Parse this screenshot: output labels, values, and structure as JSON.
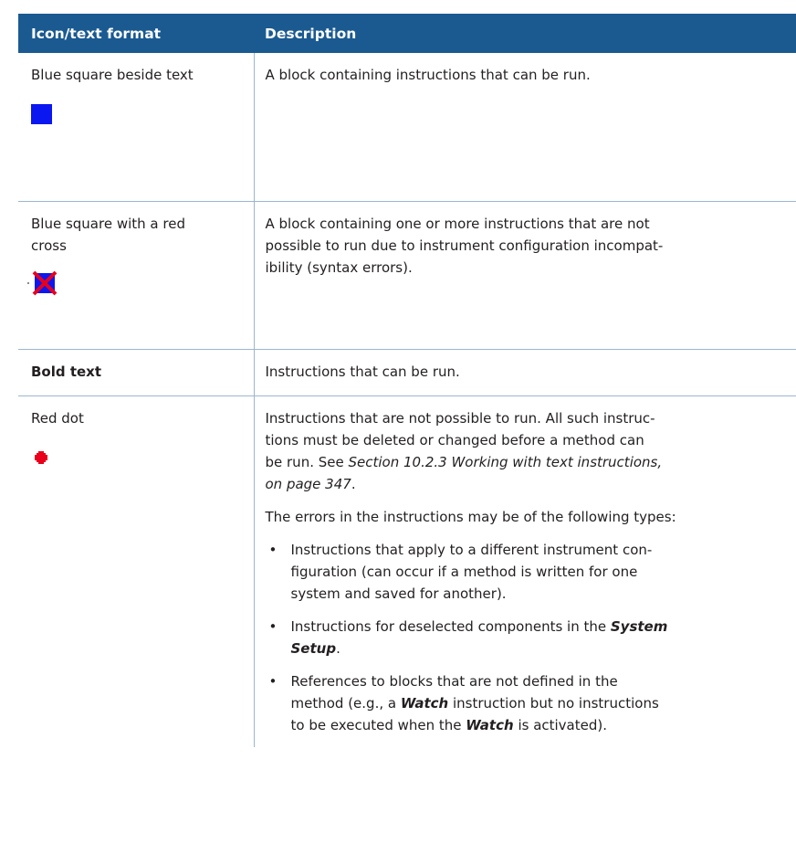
{
  "header": {
    "col1": "Icon/text format",
    "col2": "Description"
  },
  "colors": {
    "header_bg": "#1a5a91",
    "rule": "#9bb6cf",
    "blue_square": "#0b17f1",
    "red": "#e8001c"
  },
  "rows": [
    {
      "label": "Blue square beside text",
      "icon": "blue-square-icon",
      "description": "A block containing instructions that can be run."
    },
    {
      "label_line1": "Blue square with a red",
      "label_line2": "cross",
      "icon": "blue-square-red-cross-icon",
      "description_line1": "A block containing one or more instructions that are not",
      "description_line2": "possible to run due to instrument configuration incompat-",
      "description_line3": "ibility (syntax errors)."
    },
    {
      "label": "Bold text",
      "description": "Instructions that can be run."
    },
    {
      "label": "Red dot",
      "icon": "red-dot-icon",
      "para1_line1": "Instructions that are not possible to run. All such instruc-",
      "para1_line2": "tions must be deleted or changed before a method can",
      "para1_line3_prefix": "be run. See ",
      "para1_ref_line3": "Section 10.2.3 Working with text instructions,",
      "para1_ref_line4": "on page 347",
      "para1_suffix": ".",
      "para2": "The errors in the instructions may be of the following types:",
      "bullet_char": "•",
      "bullets": [
        {
          "line1": "Instructions that apply to a different instrument con-",
          "line2": "figuration (can occur if a method is written for one",
          "line3": "system and saved for another)."
        },
        {
          "text_prefix": "Instructions for deselected components in the ",
          "emph1": "System",
          "emph2": "Setup",
          "suffix": "."
        },
        {
          "line1": "References to blocks that are not defined in the",
          "line2_prefix": "method (e.g., a ",
          "emph_a": "Watch",
          "line2_mid": " instruction but no instructions",
          "line3_prefix": "to be executed when the ",
          "emph_b": "Watch",
          "line3_suffix": " is activated)."
        }
      ]
    }
  ]
}
